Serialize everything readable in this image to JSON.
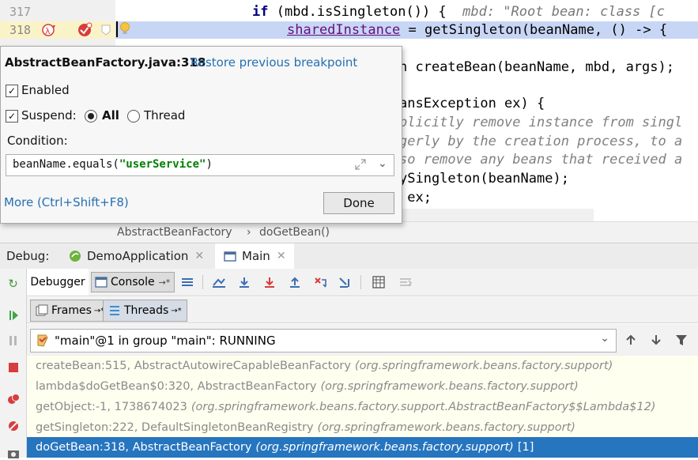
{
  "editor": {
    "lines": [
      {
        "num": "317",
        "kw": "if",
        "text": " (mbd.isSingleton()) {",
        "hint": "  mbd: \"Root bean: class [c"
      },
      {
        "num": "318",
        "field": "sharedInstance",
        "text": " = getSingleton(beanName, () -> {"
      }
    ],
    "frag_create": "n createBean(beanName, mbd, args);",
    "frag_catch": "ansException ex) {",
    "cmt1": "plicitly remove instance from singl",
    "cmt2": "gerly by the creation process, to a",
    "cmt3": "so remove any beans that received a",
    "frag_destroy": "ySingleton(beanName);",
    "frag_throw": " ex;"
  },
  "breadcrumb": {
    "class": "AbstractBeanFactory",
    "sep": "›",
    "method": "doGetBean()"
  },
  "popup": {
    "title": "AbstractBeanFactory.java:318",
    "restore_link": "Restore previous breakpoint",
    "enabled_label": "Enabled",
    "suspend_label": "Suspend:",
    "all_label": "All",
    "thread_label": "Thread",
    "condition_label": "Condition:",
    "condition_value": {
      "pre": "beanName.equals(",
      "str": "\"userService\"",
      "post": ")"
    },
    "more_link": "More (Ctrl+Shift+F8)",
    "done_label": "Done"
  },
  "debug": {
    "label": "Debug:",
    "tabs": [
      {
        "label": "DemoApplication"
      },
      {
        "label": "Main"
      }
    ],
    "debugger_tab": "Debugger",
    "console_tab": "Console",
    "arrow": "→*"
  },
  "frames_tabs": {
    "frames": "Frames",
    "threads": "Threads",
    "arrow": "→*"
  },
  "thread": {
    "label": "\"main\"@1 in group \"main\": RUNNING"
  },
  "frames": [
    {
      "method": "createBean:515, AbstractAutowireCapableBeanFactory",
      "pkg": "(org.springframework.beans.factory.support)"
    },
    {
      "method": "lambda$doGetBean$0:320, AbstractBeanFactory",
      "pkg": "(org.springframework.beans.factory.support)"
    },
    {
      "method": "getObject:-1, 1738674023",
      "pkg": "(org.springframework.beans.factory.support.AbstractBeanFactory$$Lambda$12)"
    },
    {
      "method": "getSingleton:222, DefaultSingletonBeanRegistry",
      "pkg": "(org.springframework.beans.factory.support)"
    },
    {
      "method": "doGetBean:318, AbstractBeanFactory",
      "pkg": "(org.springframework.beans.factory.support)",
      "suffix": "[1]"
    }
  ],
  "colors": {
    "selection": "#2675bf",
    "breakpoint": "#d83c3c",
    "link": "#2470b3",
    "line_highlight": "#c8d6f5"
  }
}
